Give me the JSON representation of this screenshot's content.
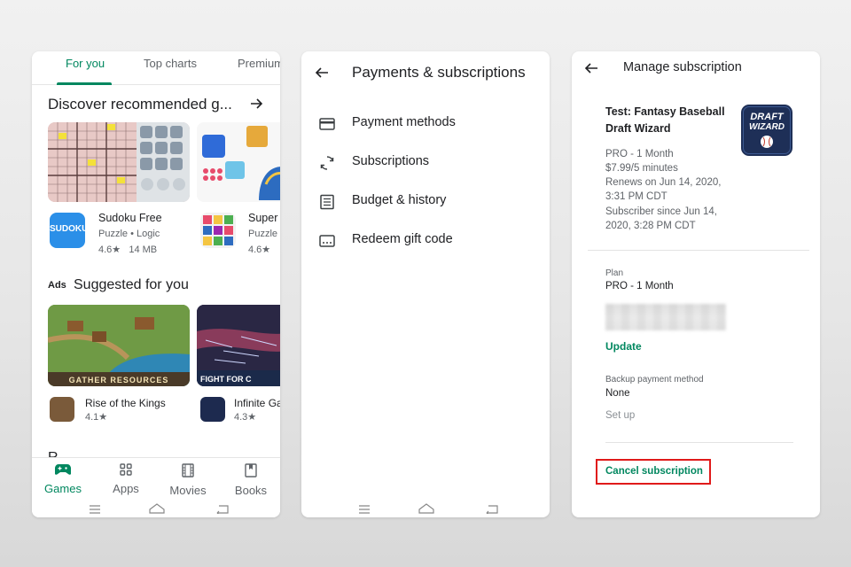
{
  "colors": {
    "accent_green": "#01875f",
    "text": "#202124",
    "muted": "#5f6368",
    "highlight_red": "#e01a1a"
  },
  "play_store": {
    "tabs": [
      "For you",
      "Top charts",
      "Premium"
    ],
    "sections": {
      "recommended": "Discover recommended g...",
      "ads_label": "Ads",
      "suggested": "Suggested for you",
      "next_partial": "R"
    },
    "apps_row1": [
      {
        "name": "Sudoku Free",
        "category": "Puzzle",
        "subcategory": "Logic",
        "rating": "4.6★",
        "size": "14 MB",
        "icon_text": "SUDOKU"
      },
      {
        "name": "Super",
        "category": "Puzzle",
        "rating": "4.6★"
      }
    ],
    "apps_row2": [
      {
        "name": "Rise of the Kings",
        "rating": "4.1★",
        "banner_text": "GATHER RESOURCES"
      },
      {
        "name": "Infinite Ga",
        "rating": "4.3★",
        "banner_text": "FIGHT FOR C"
      }
    ],
    "nav": [
      "Games",
      "Apps",
      "Movies",
      "Books"
    ]
  },
  "payments": {
    "title": "Payments & subscriptions",
    "menu": [
      "Payment methods",
      "Subscriptions",
      "Budget & history",
      "Redeem gift code"
    ]
  },
  "manage": {
    "title": "Manage subscription",
    "app_title_line1": "Test: Fantasy Baseball",
    "app_title_line2": "Draft Wizard",
    "logo_line1": "DRAFT",
    "logo_line2": "WIZARD",
    "details": [
      "PRO - 1 Month",
      "$7.99/5 minutes",
      "Renews on Jun 14, 2020,",
      "3:31 PM CDT",
      "Subscriber since Jun 14,",
      "2020, 3:28 PM CDT"
    ],
    "plan_label": "Plan",
    "plan_value": "PRO - 1 Month",
    "update": "Update",
    "backup_label": "Backup payment method",
    "backup_value": "None",
    "setup": "Set up",
    "cancel": "Cancel subscription"
  }
}
